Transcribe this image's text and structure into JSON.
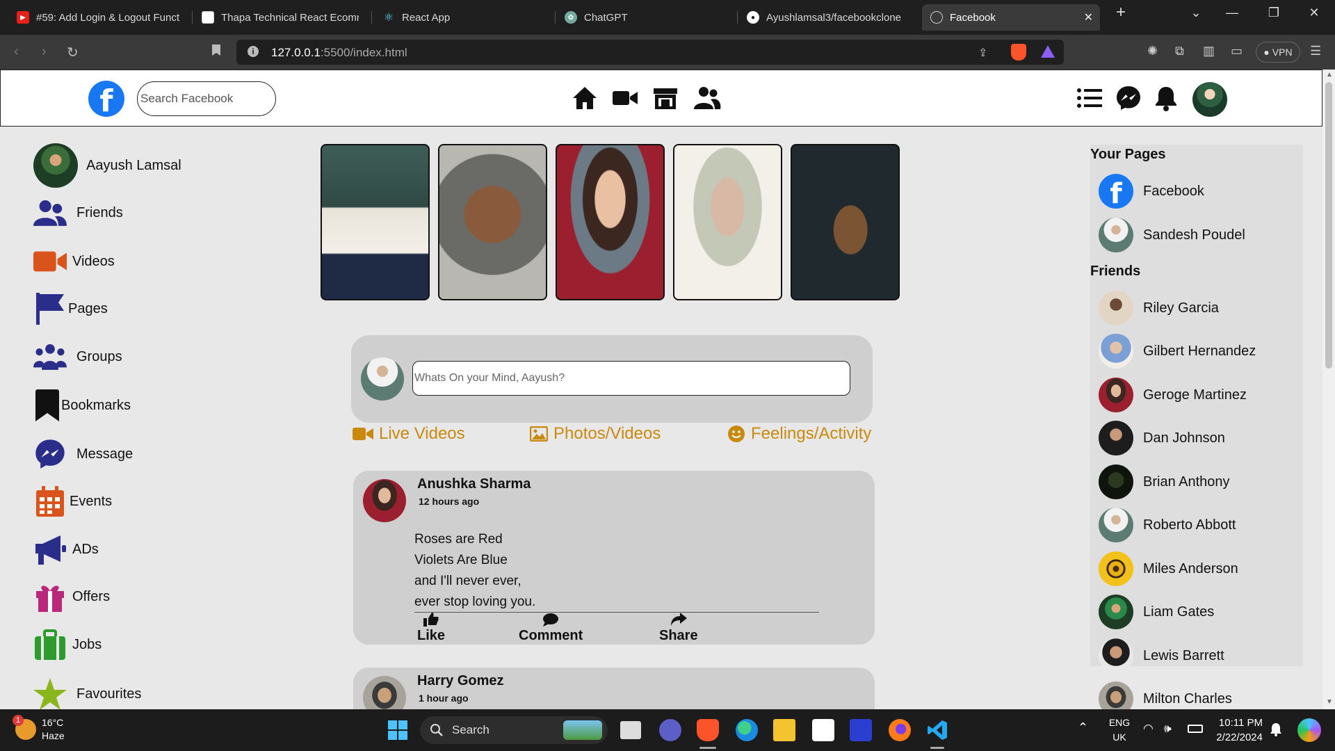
{
  "browser": {
    "tabs": [
      {
        "title": "#59: Add Login & Logout Funct",
        "icon": "youtube-icon",
        "active": false
      },
      {
        "title": "Thapa Technical React Ecomme",
        "icon": "page-icon",
        "active": false
      },
      {
        "title": "React App",
        "icon": "react-icon",
        "active": false
      },
      {
        "title": "ChatGPT",
        "icon": "chatgpt-icon",
        "active": false
      },
      {
        "title": "Ayushlamsal3/facebookclone",
        "icon": "github-icon",
        "active": false
      },
      {
        "title": "Facebook",
        "icon": "globe-icon",
        "active": true
      }
    ],
    "url_host": "127.0.0.1",
    "url_path": ":5500/index.html",
    "vpn_label": "VPN"
  },
  "header": {
    "logo": "f",
    "search_placeholder": "Search Facebook",
    "nav_icons": [
      "home-icon",
      "video-icon",
      "marketplace-icon",
      "groups-icon"
    ],
    "right_icons": [
      "menu-icon",
      "messenger-icon",
      "bell-icon"
    ]
  },
  "sidebar": {
    "profile_name": "Aayush Lamsal",
    "items": [
      {
        "label": "Friends",
        "icon": "friends-icon"
      },
      {
        "label": "Videos",
        "icon": "videos-icon"
      },
      {
        "label": "Pages",
        "icon": "flag-icon"
      },
      {
        "label": "Groups",
        "icon": "groups-icon"
      },
      {
        "label": "Bookmarks",
        "icon": "bookmark-icon"
      },
      {
        "label": "Message",
        "icon": "messenger-icon"
      },
      {
        "label": "Events",
        "icon": "calendar-icon"
      },
      {
        "label": "ADs",
        "icon": "megaphone-icon"
      },
      {
        "label": "Offers",
        "icon": "gift-icon"
      },
      {
        "label": "Jobs",
        "icon": "briefcase-icon"
      },
      {
        "label": "Favourites",
        "icon": "star-icon"
      }
    ]
  },
  "composer": {
    "placeholder": "Whats On your Mind, Aayush?",
    "actions": [
      {
        "label": "Live Videos",
        "icon": "video-camera-icon"
      },
      {
        "label": "Photos/Videos",
        "icon": "image-icon"
      },
      {
        "label": "Feelings/Activity",
        "icon": "smile-icon"
      }
    ]
  },
  "posts": [
    {
      "author": "Anushka Sharma",
      "time": "12 hours ago",
      "lines": [
        "Roses are Red",
        "Violets Are Blue",
        "and I'll never ever,",
        "ever stop loving you."
      ],
      "like": "Like",
      "comment": "Comment",
      "share": "Share"
    },
    {
      "author": "Harry Gomez",
      "time": "1 hour ago"
    }
  ],
  "right_sidebar": {
    "pages_heading": "Your Pages",
    "pages": [
      "Facebook",
      "Sandesh Poudel"
    ],
    "friends_heading": "Friends",
    "friends": [
      "Riley Garcia",
      "Gilbert Hernandez",
      "Geroge Martinez",
      "Dan Johnson",
      "Brian Anthony",
      "Roberto Abbott",
      "Miles Anderson",
      "Liam Gates",
      "Lewis Barrett",
      "Milton Charles"
    ]
  },
  "taskbar": {
    "weather_temp": "16°C",
    "weather_desc": "Haze",
    "weather_badge": "1",
    "search_label": "Search",
    "lang_1": "ENG",
    "lang_2": "UK",
    "time": "10:11 PM",
    "date": "2/22/2024"
  }
}
